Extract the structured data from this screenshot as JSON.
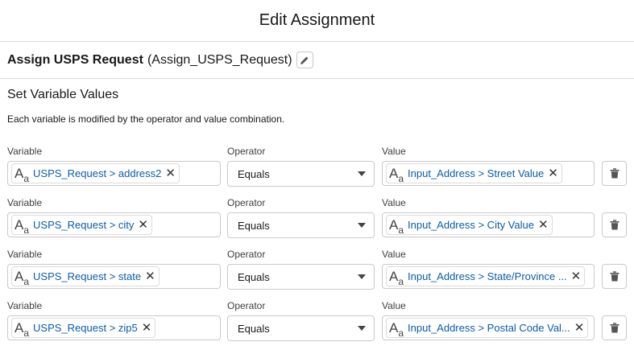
{
  "header": {
    "title": "Edit Assignment"
  },
  "element": {
    "label": "Assign USPS Request",
    "api_name": "(Assign_USPS_Request)"
  },
  "section": {
    "heading": "Set Variable Values",
    "description": "Each variable is modified by the operator and value combination."
  },
  "columns": {
    "variable": "Variable",
    "operator": "Operator",
    "value": "Value"
  },
  "rows": [
    {
      "variable": "USPS_Request > address2",
      "operator": "Equals",
      "value": "Input_Address > Street Value"
    },
    {
      "variable": "USPS_Request > city",
      "operator": "Equals",
      "value": "Input_Address > City Value"
    },
    {
      "variable": "USPS_Request > state",
      "operator": "Equals",
      "value": "Input_Address > State/Province ..."
    },
    {
      "variable": "USPS_Request > zip5",
      "operator": "Equals",
      "value": "Input_Address > Postal Code Val..."
    }
  ],
  "icons": {
    "edit": "pencil-icon",
    "text_type": "text-type-icon",
    "remove": "close-icon",
    "dropdown": "chevron-down-icon",
    "delete": "trash-icon"
  },
  "colors": {
    "link": "#0b5cab",
    "border": "#c9c9c9",
    "divider": "#dddbda"
  }
}
